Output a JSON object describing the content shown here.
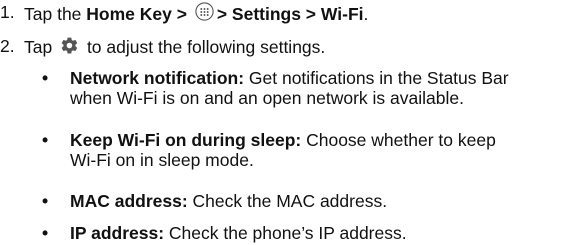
{
  "steps": [
    {
      "number": "1.",
      "prefix": "Tap the ",
      "bold_home": "Home Key >",
      "icon": "apps-grid-icon",
      "bold_tail": "> Settings > Wi-Fi",
      "end": "."
    },
    {
      "number": "2.",
      "prefix": "Tap ",
      "icon": "gear-icon",
      "suffix": " to adjust the following settings."
    }
  ],
  "settings": [
    {
      "term": "Network notification:",
      "line1": " Get notifications in the Status Bar",
      "line2": "when Wi-Fi is on and an open network is available."
    },
    {
      "term": "Keep Wi-Fi on during sleep:",
      "line1": " Choose whether to keep",
      "line2": "Wi-Fi on in sleep mode."
    },
    {
      "term": "MAC address:",
      "line1": " Check the MAC address.",
      "line2": ""
    },
    {
      "term": "IP address:",
      "line1": " Check the phone’s IP address.",
      "line2": ""
    }
  ],
  "bullet_char": "•",
  "colors": {
    "text": "#111111",
    "icon": "#555555"
  }
}
